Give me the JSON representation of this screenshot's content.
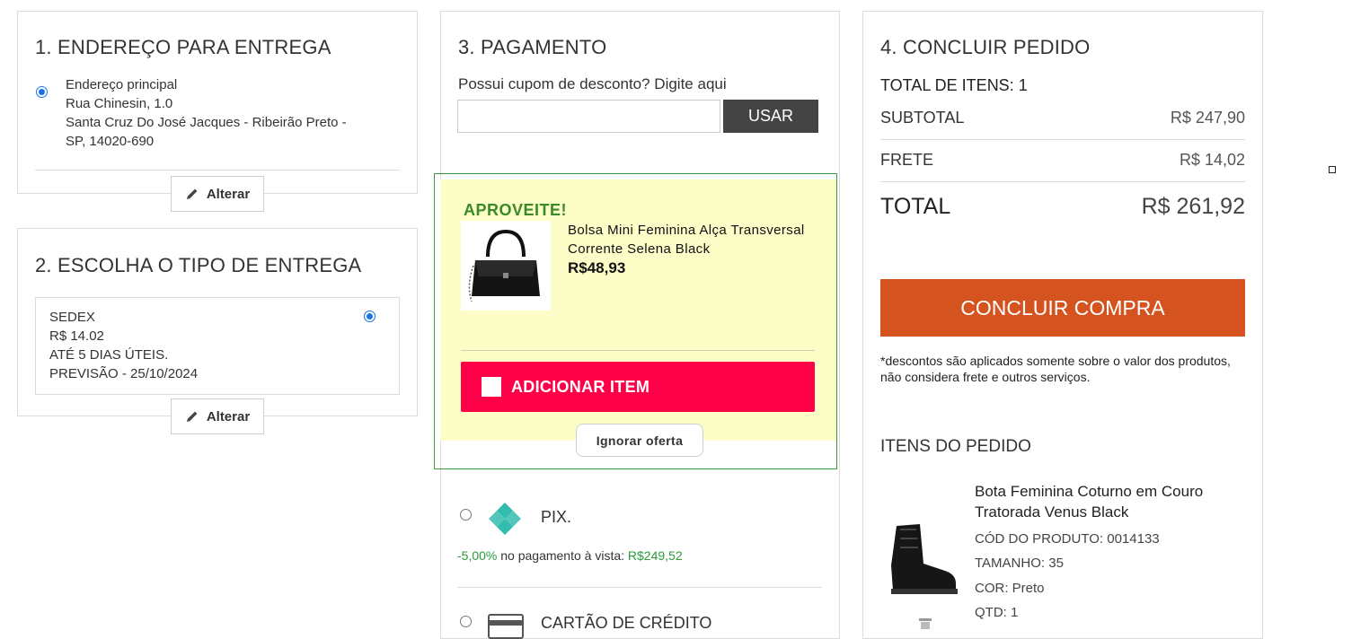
{
  "address": {
    "title": "1. ENDEREÇO PARA ENTREGA",
    "name": "Endereço principal",
    "line1": "Rua Chinesin, 1.0",
    "line2": "Santa Cruz Do José Jacques - Ribeirão Preto -",
    "line3": "SP, 14020-690",
    "change_label": "Alterar"
  },
  "delivery": {
    "title": "2. ESCOLHA O TIPO DE ENTREGA",
    "option_name": "SEDEX",
    "option_price": "R$ 14.02",
    "option_time": "ATÉ 5 DIAS ÚTEIS.",
    "option_forecast": "PREVISÃO - 25/10/2024",
    "change_label": "Alterar"
  },
  "payment": {
    "title": "3. PAGAMENTO",
    "coupon_label": "Possui cupom de desconto? Digite aqui",
    "coupon_value": "",
    "use_label": "USAR",
    "offer": {
      "heading": "APROVEITE!",
      "product_name": "Bolsa Mini Feminina Alça Transversal Corrente Selena Black",
      "price": "R$48,93",
      "add_label": "ADICIONAR ITEM",
      "ignore_label": "Ignorar oferta"
    },
    "pix_label": "PIX.",
    "pix_discount": "-5,00%",
    "pix_note": "no pagamento à vista:",
    "pix_price": "R$249,52",
    "card_label": "CARTÃO DE CRÉDITO"
  },
  "summary": {
    "title": "4. CONCLUIR PEDIDO",
    "total_items": "TOTAL DE ITENS: 1",
    "subtotal_label": "SUBTOTAL",
    "subtotal_value": "R$ 247,90",
    "shipping_label": "FRETE",
    "shipping_value": "R$ 14,02",
    "total_label": "TOTAL",
    "total_value": "R$ 261,92",
    "checkout_label": "CONCLUIR COMPRA",
    "disclaimer": "*descontos são aplicados somente sobre o valor dos produtos, não considera frete e outros serviços.",
    "items_title": "ITENS DO PEDIDO",
    "item": {
      "name": "Bota Feminina Coturno em Couro Tratorada Venus Black",
      "code": "CÓD DO PRODUTO: 0014133",
      "size": "TAMANHO: 35",
      "color": "COR: Preto",
      "qty": "QTD: 1"
    }
  },
  "colors": {
    "accent_orange": "#d4531f",
    "offer_red": "#ff0048",
    "offer_bg": "#fdfdc8",
    "offer_green": "#3a8a2a",
    "pix_teal": "#32bcad",
    "use_button": "#444444"
  }
}
